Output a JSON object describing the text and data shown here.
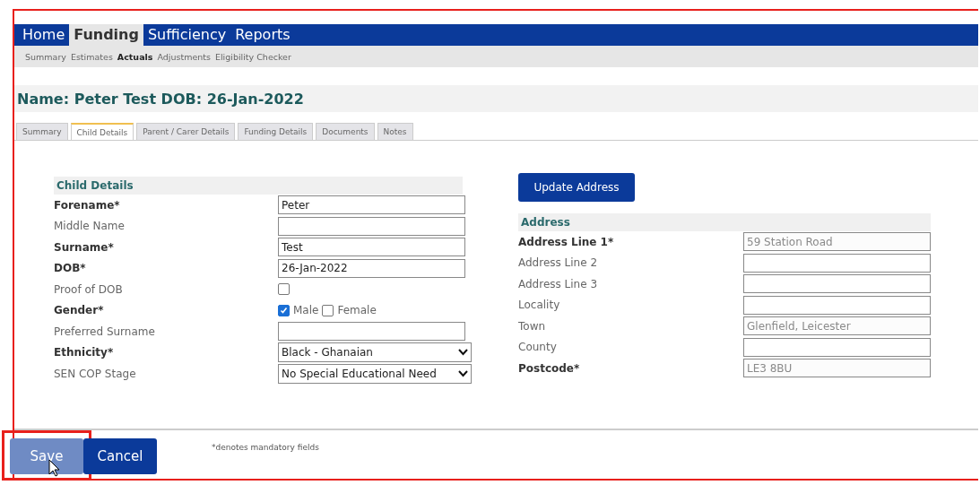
{
  "nav": [
    {
      "label": "Home",
      "selected": false
    },
    {
      "label": "Funding",
      "selected": true
    },
    {
      "label": "Sufficiency",
      "selected": false
    },
    {
      "label": "Reports",
      "selected": false
    }
  ],
  "subnav": [
    {
      "label": "Summary",
      "selected": false
    },
    {
      "label": "Estimates",
      "selected": false
    },
    {
      "label": "Actuals",
      "selected": true
    },
    {
      "label": "Adjustments",
      "selected": false
    },
    {
      "label": "Eligibility Checker",
      "selected": false
    }
  ],
  "title": "Name: Peter Test DOB: 26-Jan-2022",
  "tabs": [
    {
      "label": "Summary",
      "selected": false
    },
    {
      "label": "Child Details",
      "selected": true
    },
    {
      "label": "Parent / Carer Details",
      "selected": false
    },
    {
      "label": "Funding Details",
      "selected": false
    },
    {
      "label": "Documents",
      "selected": false
    },
    {
      "label": "Notes",
      "selected": false
    }
  ],
  "child_details": {
    "heading": "Child Details",
    "fields": [
      {
        "kind": "text",
        "label": "Forename*",
        "required": true,
        "value": "Peter"
      },
      {
        "kind": "text",
        "label": "Middle Name",
        "required": false
      },
      {
        "kind": "text",
        "label": "Surname*",
        "required": true,
        "value": "Test"
      },
      {
        "kind": "text",
        "label": "DOB*",
        "required": true,
        "value": "26-Jan-2022"
      },
      {
        "kind": "checkbox",
        "label": "Proof of DOB",
        "required": false,
        "checked": false
      },
      {
        "kind": "options",
        "label": "Gender*",
        "required": true,
        "options": [
          {
            "label": "Male",
            "checked": true
          },
          {
            "label": "Female",
            "checked": false
          }
        ]
      },
      {
        "kind": "text",
        "label": "Preferred Surname",
        "required": false
      },
      {
        "kind": "select",
        "label": "Ethnicity*",
        "required": true,
        "value": "Black - Ghanaian"
      },
      {
        "kind": "select",
        "label": "SEN COP Stage",
        "required": false,
        "value": "No Special Educational Need"
      }
    ]
  },
  "update_button": "Update Address",
  "address": {
    "heading": "Address",
    "fields": [
      {
        "label": "Address Line 1*",
        "required": true,
        "disabled": true,
        "value": "59 Station Road"
      },
      {
        "label": "Address Line 2",
        "required": false
      },
      {
        "label": "Address Line 3",
        "required": false
      },
      {
        "label": "Locality",
        "required": false
      },
      {
        "label": "Town",
        "required": false,
        "disabled": true,
        "value": "Glenfield, Leicester"
      },
      {
        "label": "County",
        "required": false
      },
      {
        "label": "Postcode*",
        "required": true,
        "disabled": true,
        "value": "LE3 8BU"
      }
    ]
  },
  "buttons": [
    {
      "label": "Save",
      "hovered": true,
      "highlighted": true
    },
    {
      "label": "Cancel",
      "hovered": false,
      "highlighted": false
    }
  ],
  "footnote": "*denotes mandatory fields"
}
